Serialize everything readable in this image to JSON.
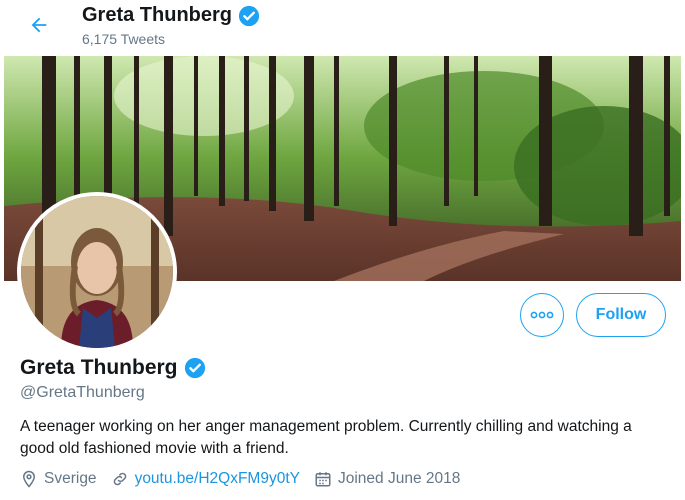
{
  "header": {
    "name": "Greta Thunberg",
    "tweet_count": "6,175 Tweets"
  },
  "profile": {
    "name": "Greta Thunberg",
    "handle": "@GretaThunberg",
    "bio": "A teenager working on her anger management problem. Currently chilling and watching a good old fashioned movie with a friend.",
    "location": "Sverige",
    "website": "youtu.be/H2QxFM9y0tY",
    "joined": "Joined June 2018"
  },
  "actions": {
    "follow_label": "Follow"
  },
  "colors": {
    "accent": "#1da1f2",
    "link": "#1b95e0",
    "secondary_text": "#657786"
  },
  "icons": {
    "back": "arrow-left-icon",
    "verified": "verified-badge-icon",
    "more": "more-options-icon",
    "location": "location-pin-icon",
    "link": "link-icon",
    "calendar": "calendar-icon"
  }
}
